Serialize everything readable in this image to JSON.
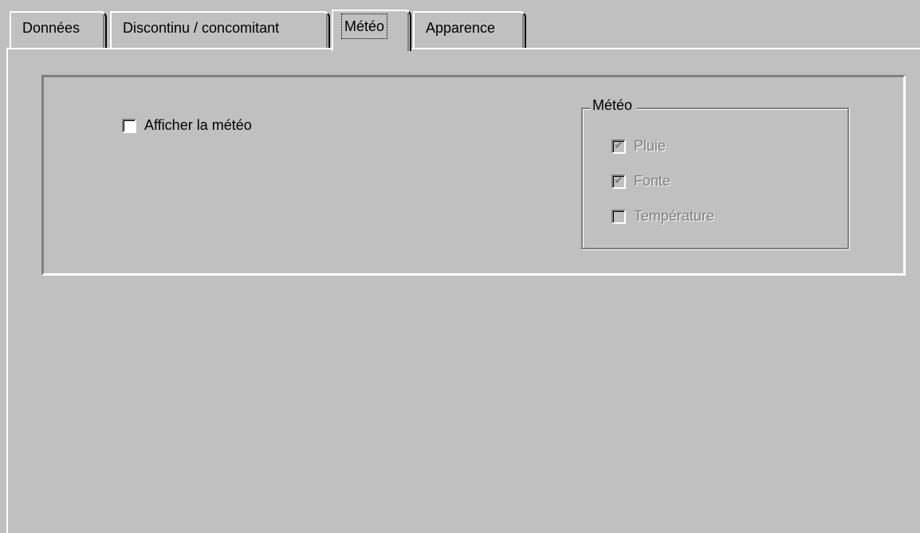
{
  "tabs": [
    {
      "label": "Données",
      "active": false
    },
    {
      "label": "Discontinu / concomitant",
      "active": false
    },
    {
      "label": "Météo",
      "active": true
    },
    {
      "label": "Apparence",
      "active": false
    }
  ],
  "show_weather": {
    "label": "Afficher la météo",
    "checked": false
  },
  "weather_group": {
    "title": "Météo",
    "options": [
      {
        "label": "Pluie",
        "checked": true,
        "enabled": false
      },
      {
        "label": "Fonte",
        "checked": true,
        "enabled": false
      },
      {
        "label": "Température",
        "checked": false,
        "enabled": false
      }
    ]
  }
}
